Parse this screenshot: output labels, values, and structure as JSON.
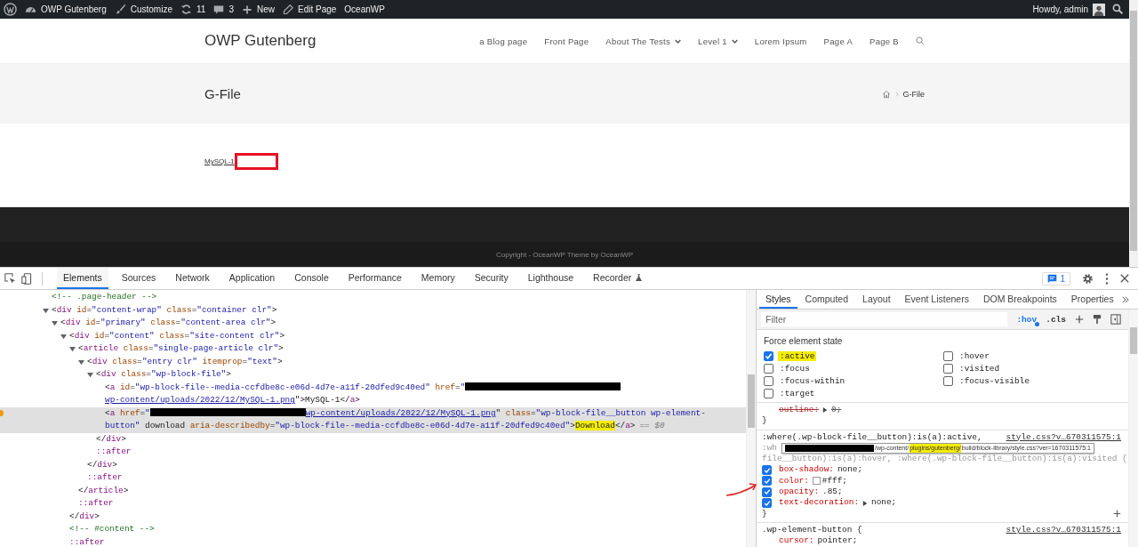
{
  "admin_bar": {
    "items": [
      {
        "kind": "wp-logo"
      },
      {
        "kind": "site",
        "label": "OWP Gutenberg"
      },
      {
        "kind": "customize",
        "label": "Customize"
      },
      {
        "kind": "updates",
        "label": "11"
      },
      {
        "kind": "comments",
        "label": "3"
      },
      {
        "kind": "new",
        "label": "New"
      },
      {
        "kind": "edit",
        "label": "Edit Page"
      },
      {
        "kind": "text",
        "label": "OceanWP"
      }
    ],
    "greeting": "Howdy, admin"
  },
  "site_header": {
    "logo": "OWP Gutenberg",
    "nav": [
      {
        "label": "a Blog page",
        "dropdown": false
      },
      {
        "label": "Front Page",
        "dropdown": false
      },
      {
        "label": "About The Tests",
        "dropdown": true
      },
      {
        "label": "Level 1",
        "dropdown": true
      },
      {
        "label": "Lorem Ipsum",
        "dropdown": false
      },
      {
        "label": "Page A",
        "dropdown": false
      },
      {
        "label": "Page B",
        "dropdown": false
      }
    ]
  },
  "page_header": {
    "title": "G-File",
    "breadcrumb": "G-File"
  },
  "content": {
    "file_link": "MySQL-1"
  },
  "footer": {
    "copyright": "Copyright - OceanWP Theme by OceanWP"
  },
  "devtools": {
    "tabs": [
      {
        "label": "Elements",
        "selected": true,
        "experimental": false
      },
      {
        "label": "Sources",
        "selected": false,
        "experimental": false
      },
      {
        "label": "Network",
        "selected": false,
        "experimental": false
      },
      {
        "label": "Application",
        "selected": false,
        "experimental": false
      },
      {
        "label": "Console",
        "selected": false,
        "experimental": false
      },
      {
        "label": "Performance",
        "selected": false,
        "experimental": false
      },
      {
        "label": "Memory",
        "selected": false,
        "experimental": false
      },
      {
        "label": "Security",
        "selected": false,
        "experimental": false
      },
      {
        "label": "Lighthouse",
        "selected": false,
        "experimental": false
      },
      {
        "label": "Recorder",
        "selected": false,
        "experimental": true
      }
    ],
    "issues_count": "1",
    "dom_tree": [
      {
        "selected": false,
        "parts": [
          {
            "kind": "comment",
            "text": "<!-- .page-header -->"
          }
        ]
      },
      {
        "selected": false,
        "expanded": true,
        "parts": [
          {
            "kind": "tag",
            "text": "<div id=\"content-wrap\" class=\"container clr\">"
          }
        ],
        "children": [
          {
            "selected": false,
            "expanded": true,
            "parts": [
              {
                "kind": "tag",
                "text": "<div id=\"primary\" class=\"content-area clr\">"
              }
            ],
            "children": [
              {
                "selected": false,
                "expanded": true,
                "parts": [
                  {
                    "kind": "tag",
                    "text": "<div id=\"content\" class=\"site-content clr\">"
                  }
                ],
                "close": "</div>",
                "children": [
                  {
                    "selected": false,
                    "expanded": true,
                    "parts": [
                      {
                        "kind": "tag",
                        "text": "<article class=\"single-page-article clr\">"
                      }
                    ],
                    "close": "</article>",
                    "children": [
                      {
                        "selected": false,
                        "expanded": true,
                        "parts": [
                          {
                            "kind": "tag",
                            "text": "<div class=\"entry clr\" itemprop=\"text\">"
                          }
                        ],
                        "close": "</div>",
                        "children": [
                          {
                            "selected": false,
                            "expanded": true,
                            "parts": [
                              {
                                "kind": "tag",
                                "text": "<div class=\"wp-block-file\">"
                              }
                            ],
                            "close": "</div>",
                            "children": [
                              {
                                "selected": false,
                                "parts": [
                                  {
                                    "kind": "tag",
                                    "text": "<a id=\"wp-block-file--media-ccfdbe8c-e06d-4d7e-a11f-20dfed9c40ed\" href=\""
                                  },
                                  {
                                    "kind": "redacted"
                                  },
                                  {
                                    "kind": "link",
                                    "text": "wp-content/uploads/2022/12/MySQL-1.png"
                                  },
                                  {
                                    "kind": "tag",
                                    "text": "\">MySQL-1</a>"
                                  }
                                ]
                              },
                              {
                                "selected": true,
                                "parts": [
                                  {
                                    "kind": "tag",
                                    "text": "<a href=\""
                                  },
                                  {
                                    "kind": "redacted"
                                  },
                                  {
                                    "kind": "link",
                                    "text": "wp-content/uploads/2022/12/MySQL-1.png"
                                  },
                                  {
                                    "kind": "tag",
                                    "text": "\" class=\"wp-block-file__button wp-element-button\" download aria-describedby=\"wp-block-file--media-ccfdbe8c-e06d-4d7e-a11f-20dfed9c40ed\">"
                                  },
                                  {
                                    "kind": "highlight",
                                    "text": "Download"
                                  },
                                  {
                                    "kind": "tag",
                                    "text": "</a>"
                                  },
                                  {
                                    "kind": "hint",
                                    "text": "== $0"
                                  }
                                ]
                              }
                            ]
                          },
                          {
                            "selected": false,
                            "parts": [
                              {
                                "kind": "pseudo",
                                "text": "::after"
                              }
                            ]
                          }
                        ]
                      },
                      {
                        "selected": false,
                        "parts": [
                          {
                            "kind": "pseudo",
                            "text": "::after"
                          }
                        ]
                      }
                    ]
                  },
                  {
                    "selected": false,
                    "parts": [
                      {
                        "kind": "pseudo",
                        "text": "::after"
                      }
                    ]
                  }
                ]
              },
              {
                "selected": false,
                "parts": [
                  {
                    "kind": "comment",
                    "text": "<!-- #content -->"
                  }
                ]
              },
              {
                "selected": false,
                "parts": [
                  {
                    "kind": "pseudo",
                    "text": "::after"
                  }
                ]
              }
            ]
          }
        ]
      }
    ],
    "styles": {
      "tabs": [
        {
          "label": "Styles",
          "selected": true
        },
        {
          "label": "Computed",
          "selected": false
        },
        {
          "label": "Layout",
          "selected": false
        },
        {
          "label": "Event Listeners",
          "selected": false
        },
        {
          "label": "DOM Breakpoints",
          "selected": false
        },
        {
          "label": "Properties",
          "selected": false
        }
      ],
      "filter_placeholder": "Filter",
      "toggles": [
        {
          "label": ":hov",
          "active": true
        },
        {
          "label": ".cls",
          "active": false
        }
      ],
      "force_state_title": "Force element state",
      "states": [
        {
          "label": ":active",
          "checked": true,
          "highlighted": true
        },
        {
          "label": ":hover",
          "checked": false,
          "highlighted": false
        },
        {
          "label": ":focus",
          "checked": false,
          "highlighted": false
        },
        {
          "label": ":visited",
          "checked": false,
          "highlighted": false
        },
        {
          "label": ":focus-within",
          "checked": false,
          "highlighted": false
        },
        {
          "label": ":focus-visible",
          "checked": false,
          "highlighted": false
        },
        {
          "label": ":target",
          "checked": false,
          "highlighted": false
        }
      ],
      "rules": [
        {
          "show_checkboxes": false,
          "add_button": false,
          "closing": "}",
          "properties": [
            {
              "name": "outline:",
              "value": "0;",
              "overridden": true,
              "expandable": true,
              "swatch": false
            }
          ]
        },
        {
          "show_checkboxes": true,
          "add_button": true,
          "selector_lines": [
            ":where(.wp-block-file__button):is(a):active,",
            ":wh",
            "file__button):is(a):hover, :where(.wp-block-file__button):is(a):visited {"
          ],
          "source": "style.css?v…670311575:1",
          "tooltip": [
            {
              "kind": "redacted"
            },
            {
              "kind": "text",
              "text": "/wp-content/"
            },
            {
              "kind": "highlight",
              "text": "plugins/gutenberg/"
            },
            {
              "kind": "text",
              "text": "build/block-library/style.css?ver=1670311575:1"
            }
          ],
          "closing": "}",
          "properties": [
            {
              "name": "box-shadow:",
              "value": "none;",
              "checked": true,
              "overridden": false,
              "expandable": false,
              "swatch": false
            },
            {
              "name": "color:",
              "value": "#fff;",
              "checked": true,
              "overridden": false,
              "expandable": false,
              "swatch": true
            },
            {
              "name": "opacity:",
              "value": ".85;",
              "checked": true,
              "overridden": false,
              "expandable": false,
              "swatch": false
            },
            {
              "name": "text-decoration:",
              "value": "none;",
              "checked": true,
              "overridden": false,
              "expandable": true,
              "swatch": false
            }
          ]
        },
        {
          "show_checkboxes": false,
          "selector_lines": [
            ".wp-element-button {"
          ],
          "source": "style.css?v…670311575:1",
          "properties": [
            {
              "name": "cursor:",
              "value": "pointer;",
              "overridden": false,
              "expandable": false,
              "swatch": false
            }
          ]
        }
      ]
    }
  }
}
